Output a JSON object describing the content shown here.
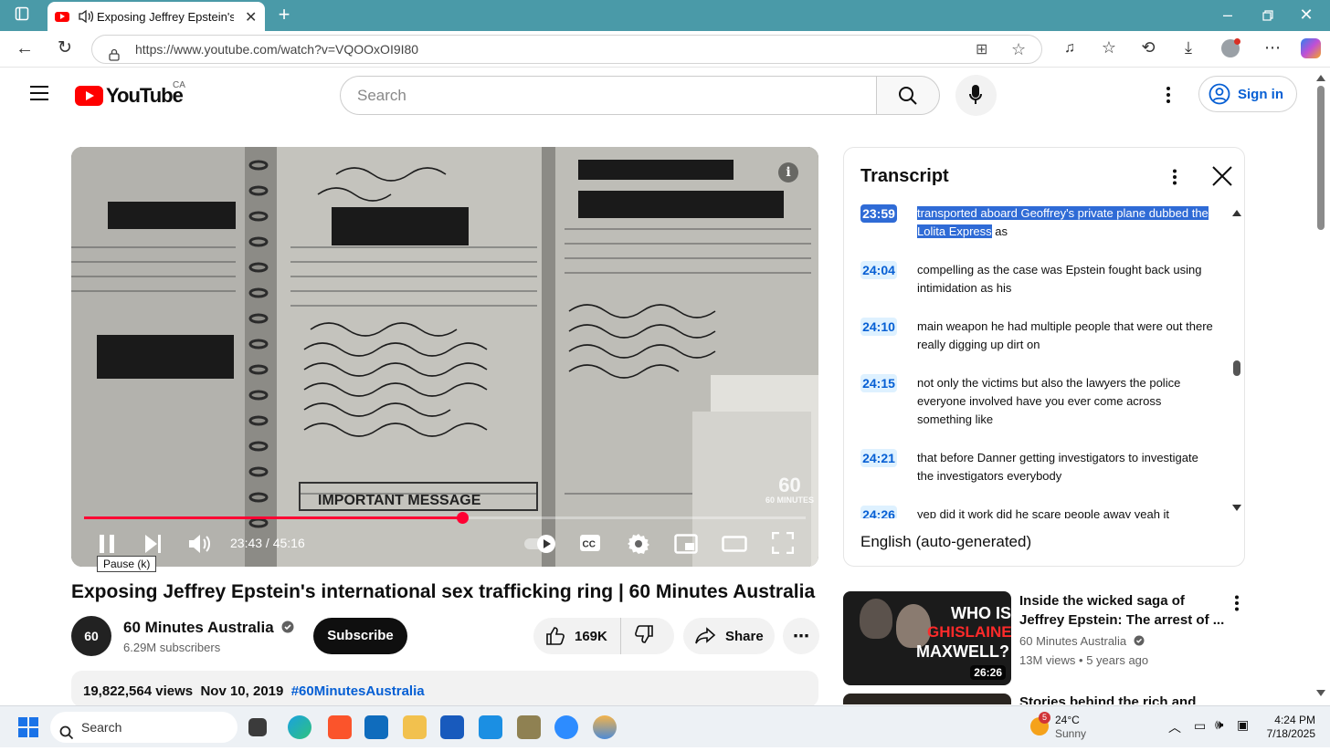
{
  "browser": {
    "tab_title": "Exposing Jeffrey Epstein's int",
    "url": "https://www.youtube.com/watch?v=VQOOxOI9I80"
  },
  "header": {
    "logo_text": "YouTube",
    "region": "CA",
    "search_placeholder": "Search",
    "signin_label": "Sign in"
  },
  "player": {
    "time_current": "23:43",
    "time_total": "45:16",
    "time_display": "23:43 / 45:16",
    "progress_fraction": 0.524,
    "pause_tooltip": "Pause (k)",
    "watermark": "60 MINUTES"
  },
  "video": {
    "title": "Exposing Jeffrey Epstein's international sex trafficking ring | 60 Minutes Australia",
    "channel": "60 Minutes Australia",
    "subscribers": "6.29M subscribers",
    "subscribe_label": "Subscribe",
    "likes": "169K",
    "share_label": "Share",
    "views": "19,822,564 views",
    "date": "Nov 10, 2019",
    "hashtag": "#60MinutesAustralia"
  },
  "transcript": {
    "title": "Transcript",
    "language": "English (auto-generated)",
    "segments": [
      {
        "time": "23:59",
        "text_highlight": "transported aboard Geoffrey's private plane dubbed the Lolita Express",
        "text_rest": " as"
      },
      {
        "time": "24:04",
        "text": "compelling as the case was Epstein fought back using intimidation as his"
      },
      {
        "time": "24:10",
        "text": "main weapon he had multiple people that were out there really digging up dirt on"
      },
      {
        "time": "24:15",
        "text": "not only the victims but also the lawyers the police everyone involved have you ever come across something like"
      },
      {
        "time": "24:21",
        "text": "that before Danner getting investigators to investigate the investigators everybody"
      },
      {
        "time": "24:26",
        "text": "yep did it work did he scare people away yeah it"
      }
    ]
  },
  "recommendations": [
    {
      "title": "Inside the wicked saga of Jeffrey Epstein: The arrest of ...",
      "channel": "60 Minutes Australia",
      "views": "13M views",
      "age": "5 years ago",
      "duration": "26:26",
      "thumb_text_1": "WHO IS",
      "thumb_text_2": "GHISLAINE",
      "thumb_text_3": "MAXWELL?"
    },
    {
      "title": "Stories behind the rich and"
    }
  ],
  "taskbar": {
    "search_label": "Search",
    "weather_temp": "24°C",
    "weather_desc": "Sunny",
    "weather_badge": "5",
    "time": "4:24 PM",
    "date": "7/18/2025"
  },
  "colors": {
    "accent_blue": "#065fd4",
    "youtube_red": "#ff0000",
    "progress_red": "#ff0033",
    "tab_bar": "#4a9aa8"
  }
}
